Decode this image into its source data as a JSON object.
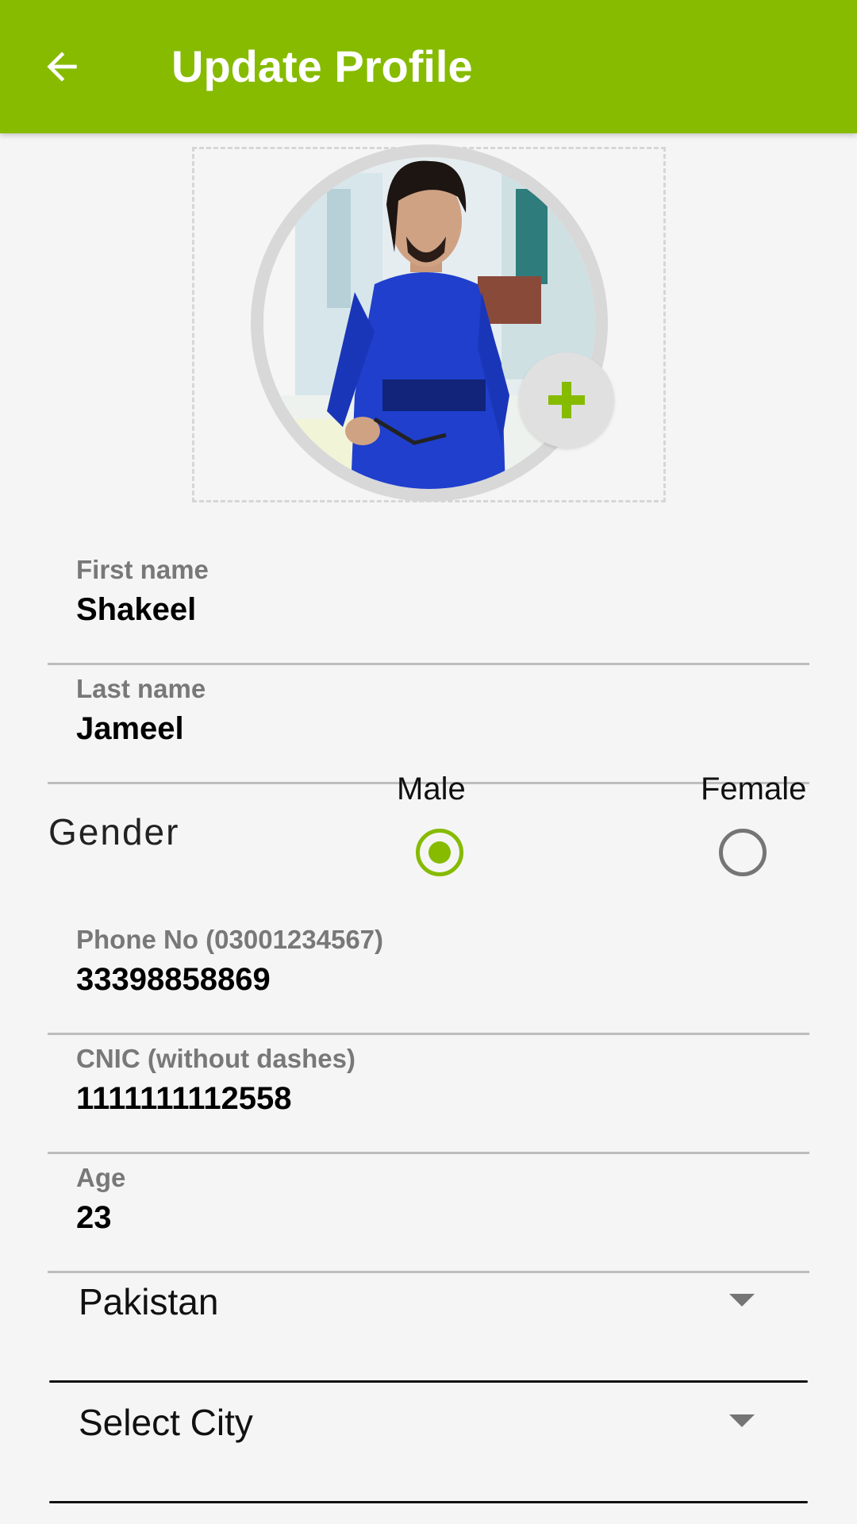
{
  "appbar": {
    "title": "Update Profile",
    "back_icon": "arrow-left-icon",
    "color": "#86bb00"
  },
  "photo": {
    "add_icon": "plus-icon",
    "avatar_description_icon": "profile-photo"
  },
  "fields": {
    "first_name": {
      "label": "First name",
      "value": "Shakeel"
    },
    "last_name": {
      "label": "Last name",
      "value": "Jameel"
    },
    "phone": {
      "label": "Phone No (03001234567)",
      "value": "33398858869"
    },
    "cnic": {
      "label": "CNIC (without dashes)",
      "value": "1111111112558"
    },
    "age": {
      "label": "Age",
      "value": "23"
    }
  },
  "gender": {
    "label": "Gender",
    "options": [
      {
        "label": "Male",
        "selected": true
      },
      {
        "label": "Female",
        "selected": false
      }
    ]
  },
  "country_dropdown": {
    "value": "Pakistan"
  },
  "city_dropdown": {
    "value": "Select City"
  }
}
